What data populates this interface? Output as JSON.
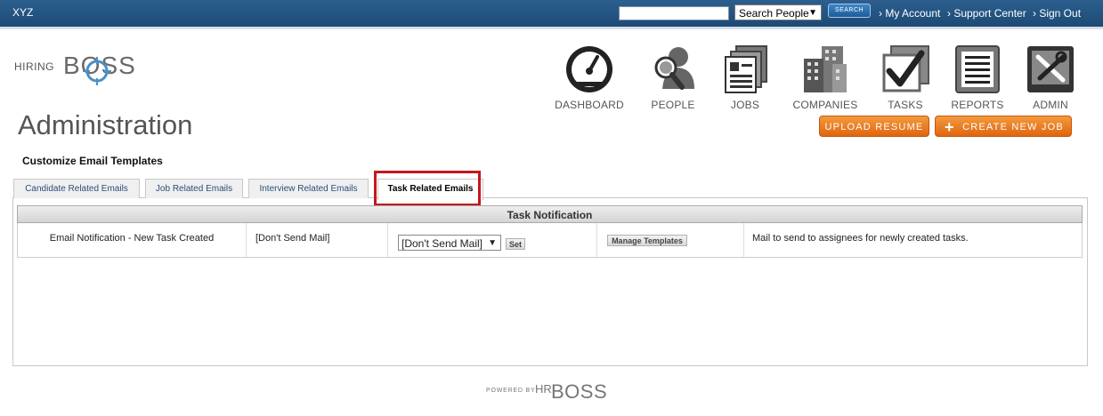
{
  "topbar": {
    "company": "XYZ",
    "search_placeholder": "",
    "search_scope": "Search People",
    "search_button": "SEARCH",
    "links": [
      "› My Account",
      "› Support Center",
      "› Sign Out"
    ]
  },
  "logo": {
    "hiring": "HIRING",
    "boss": "BOSS"
  },
  "nav": [
    {
      "label": "DASHBOARD",
      "icon": "dashboard-gauge-icon"
    },
    {
      "label": "PEOPLE",
      "icon": "people-search-icon"
    },
    {
      "label": "JOBS",
      "icon": "jobs-files-icon"
    },
    {
      "label": "COMPANIES",
      "icon": "companies-buildings-icon"
    },
    {
      "label": "TASKS",
      "icon": "tasks-checkbox-icon"
    },
    {
      "label": "REPORTS",
      "icon": "reports-document-icon"
    },
    {
      "label": "ADMIN",
      "icon": "admin-tools-icon"
    }
  ],
  "page": {
    "title": "Administration",
    "upload_button": "UPLOAD RESUME",
    "create_job_button": "CREATE NEW JOB",
    "section_title": "Customize Email Templates"
  },
  "tabs": [
    {
      "label": "Candidate Related Emails",
      "active": false
    },
    {
      "label": "Job Related Emails",
      "active": false
    },
    {
      "label": "Interview Related Emails",
      "active": false
    },
    {
      "label": "Task Related Emails",
      "active": true
    }
  ],
  "table": {
    "header": "Task Notification",
    "row": {
      "name": "Email Notification - New Task Created",
      "current": "[Don't Send Mail]",
      "select_value": "[Don't Send Mail]",
      "set_button": "Set",
      "manage_button": "Manage Templates",
      "description": "Mail to send to assignees for newly created tasks."
    }
  },
  "footer": {
    "powered": "POWERED BY",
    "hr": "HR",
    "boss": "BOSS"
  },
  "colors": {
    "topbar": "#2c5f8e",
    "orange": "#e0650f",
    "highlight": "#c6171c"
  }
}
